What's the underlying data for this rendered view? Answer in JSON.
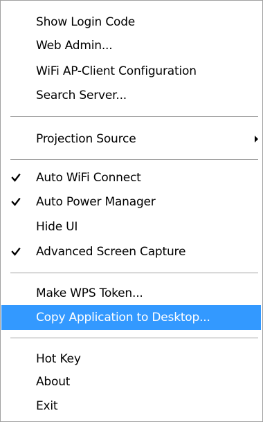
{
  "menu": {
    "items": [
      {
        "label": "Show Login Code"
      },
      {
        "label": "Web Admin..."
      },
      {
        "label": "WiFi AP-Client Configuration"
      },
      {
        "label": "Search Server..."
      },
      {
        "label": "Projection Source",
        "submenu": true
      },
      {
        "label": "Auto WiFi Connect",
        "checked": true
      },
      {
        "label": "Auto Power Manager",
        "checked": true
      },
      {
        "label": "Hide UI",
        "checked": false
      },
      {
        "label": "Advanced Screen Capture",
        "checked": true
      },
      {
        "label": "Make WPS Token..."
      },
      {
        "label": "Copy Application to Desktop...",
        "highlighted": true
      },
      {
        "label": "Hot Key"
      },
      {
        "label": "About"
      },
      {
        "label": "Exit"
      }
    ],
    "icons": {
      "check": "checkmark-icon",
      "submenu": "submenu-arrow-icon"
    },
    "colors": {
      "highlight_background": "#3399ff",
      "highlight_text": "#ffffff",
      "separator": "#a0a0a0"
    }
  }
}
